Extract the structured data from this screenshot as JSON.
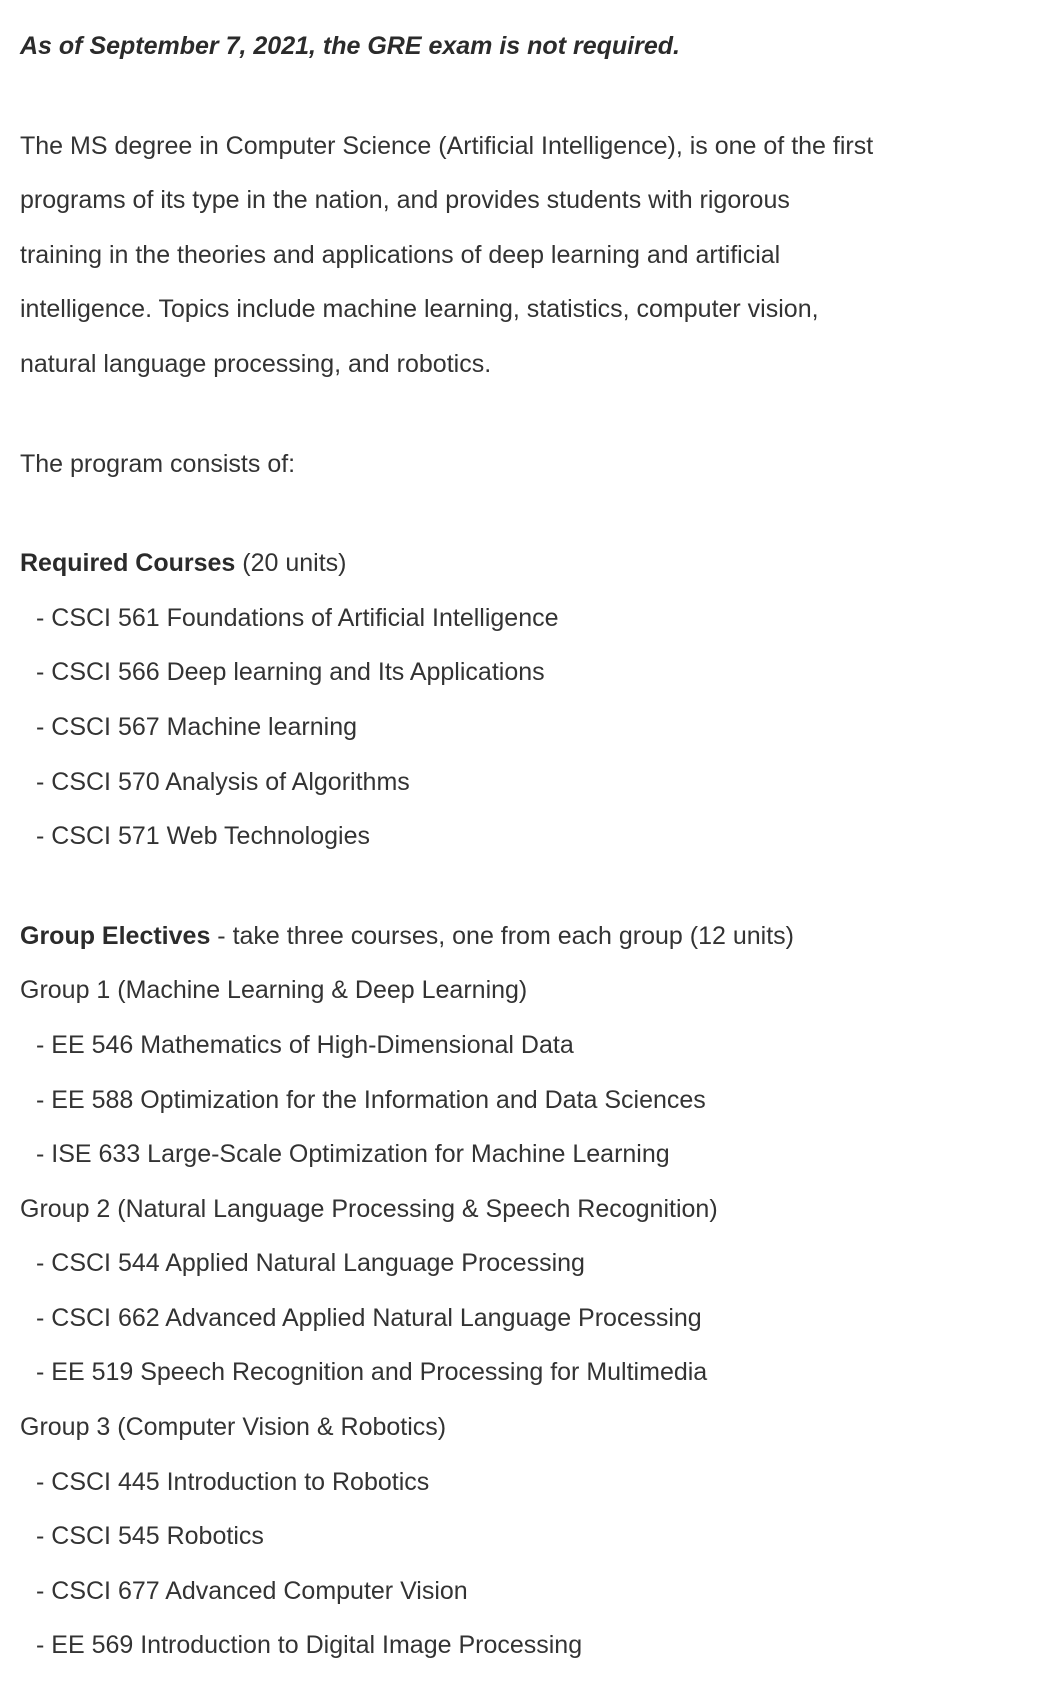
{
  "notice": "As of September 7, 2021, the GRE exam is not required.",
  "intro_lines": [
    "The MS degree in Computer Science (Artificial Intelligence), is one of the first",
    "programs of its type in the nation, and provides students with rigorous",
    "training in the theories and applications of deep learning and artificial",
    "intelligence. Topics include machine learning, statistics, computer vision,",
    "natural language processing, and robotics."
  ],
  "program_intro": "The program consists of:",
  "required": {
    "title": "Required Courses",
    "units": "(20 units)",
    "courses": [
      "- CSCI 561 Foundations of Artificial Intelligence",
      "- CSCI 566 Deep learning and Its Applications",
      "- CSCI 567 Machine learning",
      "- CSCI 570 Analysis of Algorithms",
      "- CSCI 571 Web Technologies"
    ]
  },
  "electives": {
    "title": "Group Electives",
    "desc": " - take three courses, one from each group (12 units)",
    "groups": [
      {
        "name": "Group 1 (Machine Learning & Deep Learning)",
        "courses": [
          "- EE 546 Mathematics of High-Dimensional Data",
          "- EE 588 Optimization for the Information and Data Sciences",
          "- ISE 633 Large-Scale Optimization for Machine Learning"
        ]
      },
      {
        "name": "Group 2 (Natural Language Processing & Speech Recognition)",
        "courses": [
          "- CSCI 544 Applied Natural Language Processing",
          "- CSCI 662 Advanced Applied Natural Language Processing",
          "- EE 519 Speech Recognition and Processing for Multimedia"
        ]
      },
      {
        "name": "Group 3 (Computer Vision & Robotics)",
        "courses": [
          "- CSCI 445 Introduction to Robotics",
          "- CSCI 545 Robotics",
          "- CSCI 677 Advanced Computer Vision",
          "- EE 569 Introduction to Digital Image Processing"
        ]
      }
    ]
  }
}
